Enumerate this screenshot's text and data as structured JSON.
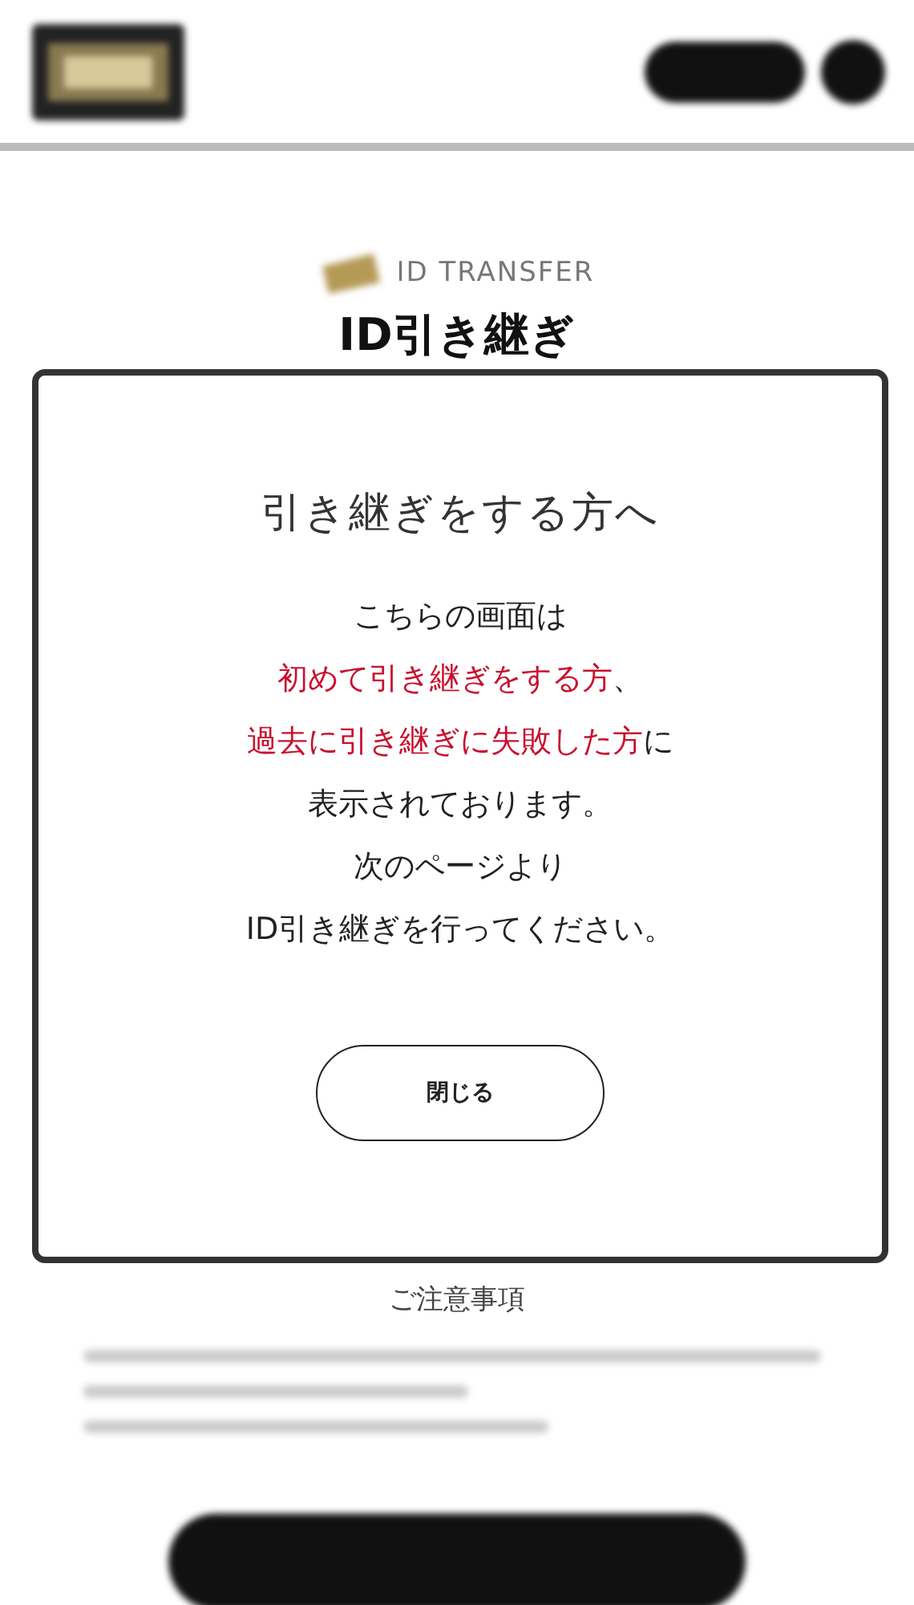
{
  "page": {
    "eyebrow": "ID TRANSFER",
    "title": "ID引き継ぎ",
    "notice_heading": "ご注意事項"
  },
  "modal": {
    "title": "引き継ぎをする方へ",
    "lines": [
      [
        {
          "text": "こちらの画面は",
          "emphasis": false
        }
      ],
      [
        {
          "text": "初めて引き継ぎをする方",
          "emphasis": true
        },
        {
          "text": "、",
          "emphasis": false
        }
      ],
      [
        {
          "text": "過去に引き継ぎに失敗した方",
          "emphasis": true
        },
        {
          "text": "に",
          "emphasis": false
        }
      ],
      [
        {
          "text": "表示されております。",
          "emphasis": false
        }
      ],
      [
        {
          "text": "次のページより",
          "emphasis": false
        }
      ],
      [
        {
          "text": "ID引き継ぎを行ってください。",
          "emphasis": false
        }
      ]
    ],
    "close_button": "閉じる"
  }
}
